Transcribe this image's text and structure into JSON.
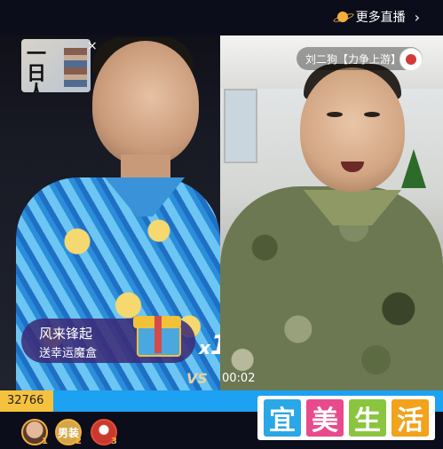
{
  "header": {
    "more_live_label": "更多直播",
    "chevron": "›"
  },
  "left_stream": {
    "pip_title": "一日人生",
    "pip_close": "×",
    "gift_banner": {
      "line1": "风来锋起",
      "line2": "送幸运魔盒"
    },
    "gift_icon": "gift-box-icon",
    "combo_prefix": "x",
    "combo_count": "1"
  },
  "right_stream": {
    "streamer_name": "刘二狗【力争上游】"
  },
  "battle": {
    "vs_label": "VS",
    "timer": "00:02",
    "score_left": "32766",
    "left_share": 0.12,
    "colors": {
      "left": "#f6c23e",
      "right": "#1da1f2"
    }
  },
  "ranking": [
    {
      "rank": "1",
      "label": ""
    },
    {
      "rank": "2",
      "label": "男装"
    },
    {
      "rank": "3",
      "label": ""
    }
  ],
  "watermark": {
    "chars": [
      "宜",
      "美",
      "生",
      "活"
    ]
  }
}
